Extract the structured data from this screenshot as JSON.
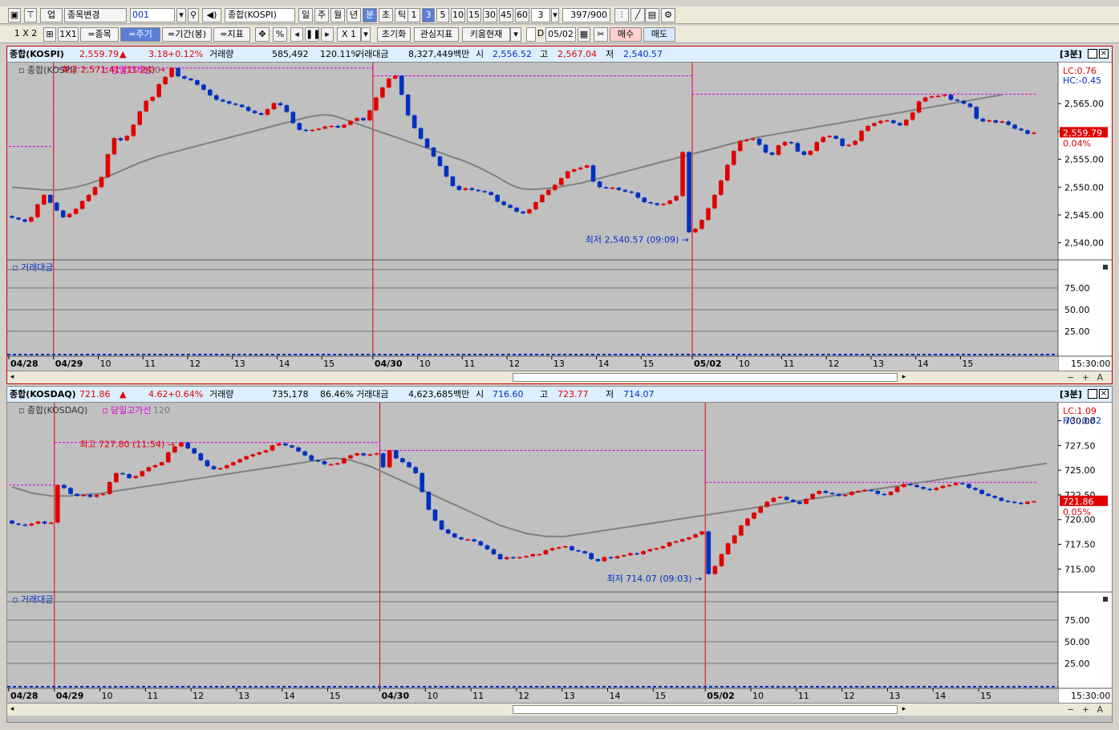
{
  "toolbar1": {
    "market": "업",
    "item_change": "종목변경",
    "code": "001",
    "index_name": "종합(KOSPI)",
    "periods": [
      "일",
      "주",
      "월",
      "년",
      "분",
      "초",
      "틱"
    ],
    "selected_period": "분",
    "intervals": [
      "1",
      "3",
      "5",
      "10",
      "15",
      "30",
      "45",
      "60"
    ],
    "selected_interval": "3",
    "interval_value": "3",
    "count": "397",
    "count_total": "/900"
  },
  "toolbar2": {
    "layout_label": "1 X 2",
    "onexone": "1X1",
    "item_btn": "=종목",
    "cycle_btn": "=주기",
    "term_btn": "=기간(봉)",
    "indicator_btn": "=지표",
    "percent": "%",
    "multiplier": "X 1",
    "reset_btn": "초기화",
    "interest_btn": "관심지표",
    "kiwoom_btn": "키움현재",
    "date_check": "D",
    "date": "05/02",
    "buy_btn": "매수",
    "sell_btn": "매도"
  },
  "panes": [
    {
      "header": {
        "name": "종합(KOSPI)",
        "price": "2,559.79",
        "arrow": "▲",
        "change": "3.18",
        "pct": "+0.12%",
        "vol_label": "거래량",
        "vol": "585,492",
        "vol_pct": "120.11%",
        "amt_label": "거래대금",
        "amt": "8,327,449백만",
        "open_label": "시",
        "open": "2,556.52",
        "high_label": "고",
        "high": "2,567.04",
        "low_label": "저",
        "low": "2,540.57",
        "period_label": "[3분]"
      },
      "chart_data": {
        "type": "candlestick",
        "legend": [
          "종합(KOSPI)",
          "당일고가선",
          "120"
        ],
        "lc": "LC:0.76",
        "hc": "HC:-0.45",
        "yticks": [
          "2,565.00",
          "2,560.00",
          "2,555.00",
          "2,550.00",
          "2,545.00",
          "2,540.00"
        ],
        "yvals": [
          2565,
          2560,
          2555,
          2550,
          2545,
          2540
        ],
        "ylim": [
          2537.5,
          2571.8
        ],
        "last_label": "2,559.79",
        "last_pct": "0.04%",
        "last": 2559.79,
        "high_annot": "최고 2,571.41 (11:24)",
        "high_value": 2571.41,
        "low_annot": "최저 2,540.57 (09:09)",
        "low_value": 2540.57,
        "close_series": [
          2544.5,
          2544.2,
          2543.8,
          2544.6,
          2546.9,
          2548.6,
          2547.2,
          2545.8,
          2544.6,
          2545.2,
          2546.1,
          2547.5,
          2548.6,
          2550.0,
          2551.8,
          2555.9,
          2558.8,
          2558.4,
          2559.2,
          2561.2,
          2563.6,
          2565.5,
          2566.2,
          2568.5,
          2569.8,
          2571.4,
          2569.9,
          2569.5,
          2569.2,
          2568.4,
          2567.5,
          2566.5,
          2565.7,
          2565.4,
          2565.0,
          2564.8,
          2564.4,
          2563.7,
          2563.3,
          2563.0,
          2564.0,
          2565.1,
          2564.7,
          2563.5,
          2561.5,
          2560.3,
          2560.1,
          2560.3,
          2560.5,
          2560.9,
          2561.0,
          2560.7,
          2561.2,
          2561.9,
          2562.4,
          2562.0,
          2563.8,
          2566.1,
          2567.9,
          2569.5,
          2570.0,
          2566.6,
          2562.9,
          2560.6,
          2558.7,
          2557.1,
          2555.5,
          2553.8,
          2551.9,
          2550.2,
          2549.5,
          2549.8,
          2549.5,
          2549.3,
          2549.1,
          2548.6,
          2547.4,
          2546.8,
          2546.3,
          2545.6,
          2545.3,
          2546.0,
          2547.3,
          2548.6,
          2549.5,
          2550.4,
          2551.6,
          2552.8,
          2553.2,
          2553.5,
          2553.9,
          2551.0,
          2550.0,
          2549.8,
          2549.9,
          2549.5,
          2549.2,
          2549.0,
          2548.1,
          2547.3,
          2547.1,
          2546.8,
          2547.0,
          2547.6,
          2548.4,
          2556.3,
          2541.9,
          2542.5,
          2544.1,
          2546.2,
          2548.6,
          2551.2,
          2554.0,
          2556.5,
          2558.3,
          2558.5,
          2558.7,
          2557.6,
          2556.2,
          2555.8,
          2557.5,
          2558.1,
          2557.9,
          2556.4,
          2555.8,
          2556.5,
          2558.1,
          2559.0,
          2559.2,
          2558.7,
          2557.4,
          2557.6,
          2558.3,
          2560.1,
          2561.0,
          2561.5,
          2561.9,
          2562.0,
          2561.5,
          2561.1,
          2562.1,
          2563.4,
          2565.4,
          2566.1,
          2566.3,
          2566.4,
          2566.6,
          2565.7,
          2565.5,
          2565.0,
          2564.4,
          2562.3,
          2561.8,
          2562.0,
          2561.6,
          2561.8,
          2561.2,
          2560.5,
          2560.2,
          2559.6,
          2559.8
        ],
        "ma120": [
          2550.0,
          2549.9,
          2549.8,
          2549.7,
          2549.6,
          2549.5,
          2549.5,
          2549.5,
          2549.6,
          2549.8,
          2550.0,
          2550.3,
          2550.6,
          2551.0,
          2551.4,
          2551.9,
          2552.4,
          2552.9,
          2553.4,
          2553.9,
          2554.4,
          2554.8,
          2555.2,
          2555.6,
          2555.9,
          2556.2,
          2556.5,
          2556.8,
          2557.1,
          2557.4,
          2557.7,
          2558.0,
          2558.3,
          2558.6,
          2558.9,
          2559.2,
          2559.5,
          2559.8,
          2560.1,
          2560.4,
          2560.7,
          2561.0,
          2561.3,
          2561.6,
          2561.9,
          2562.2,
          2562.5,
          2562.7,
          2562.9,
          2563.0,
          2562.9,
          2562.6,
          2562.2,
          2561.8,
          2561.4,
          2561.0,
          2560.6,
          2560.2,
          2559.8,
          2559.4,
          2559.0,
          2558.6,
          2558.2,
          2557.8,
          2557.4,
          2557.0,
          2556.6,
          2556.2,
          2555.8,
          2555.4,
          2555.0,
          2554.6,
          2554.1,
          2553.6,
          2553.0,
          2552.4,
          2551.8,
          2551.1,
          2550.5,
          2550.0,
          2549.7,
          2549.6,
          2549.6,
          2549.7,
          2549.8,
          2549.9,
          2550.1,
          2550.3,
          2550.5,
          2550.7,
          2551.0,
          2551.3,
          2551.6,
          2551.9,
          2552.2,
          2552.5,
          2552.8,
          2553.1,
          2553.4,
          2553.7,
          2554.0,
          2554.3,
          2554.6,
          2554.9,
          2555.2,
          2555.5,
          2555.8,
          2556.1,
          2556.4,
          2556.7,
          2557.0,
          2557.3,
          2557.6,
          2557.9,
          2558.2,
          2558.5,
          2558.8,
          2559.0,
          2559.2,
          2559.4,
          2559.6,
          2559.8,
          2560.0,
          2560.2,
          2560.4,
          2560.6,
          2560.8,
          2561.0,
          2561.2,
          2561.4,
          2561.6,
          2561.8,
          2562.0,
          2562.2,
          2562.4,
          2562.6,
          2562.8,
          2563.0,
          2563.2,
          2563.4,
          2563.6,
          2563.8,
          2564.0,
          2564.2,
          2564.4,
          2564.6,
          2564.8,
          2565.0,
          2565.2,
          2565.4,
          2565.6,
          2565.8,
          2566.0,
          2566.2,
          2566.4,
          2566.6
        ],
        "day_starts": [
          7,
          57,
          107
        ],
        "day_high": [
          2557.3,
          2571.4,
          2570.0,
          2566.7
        ],
        "sub_title": "거래대금",
        "sub_yticks": [
          "75.00",
          "50.00",
          "25.00"
        ],
        "sub_yvals": [
          75,
          50,
          25
        ],
        "time_right": "15:30:00",
        "x_labels": [
          {
            "i": 0,
            "t": "04/28"
          },
          {
            "i": 7,
            "t": "04/29"
          },
          {
            "i": 14,
            "t": "10"
          },
          {
            "i": 21,
            "t": "11"
          },
          {
            "i": 28,
            "t": "12"
          },
          {
            "i": 35,
            "t": "13"
          },
          {
            "i": 42,
            "t": "14"
          },
          {
            "i": 49,
            "t": "15"
          },
          {
            "i": 57,
            "t": "04/30"
          },
          {
            "i": 64,
            "t": "10"
          },
          {
            "i": 71,
            "t": "11"
          },
          {
            "i": 78,
            "t": "12"
          },
          {
            "i": 85,
            "t": "13"
          },
          {
            "i": 92,
            "t": "14"
          },
          {
            "i": 99,
            "t": "15"
          },
          {
            "i": 107,
            "t": "05/02"
          },
          {
            "i": 114,
            "t": "10"
          },
          {
            "i": 121,
            "t": "11"
          },
          {
            "i": 128,
            "t": "12"
          },
          {
            "i": 135,
            "t": "13"
          },
          {
            "i": 142,
            "t": "14"
          },
          {
            "i": 149,
            "t": "15"
          }
        ]
      }
    },
    {
      "header": {
        "name": "종합(KOSDAQ)",
        "price": "721.86",
        "arrow": "▲",
        "change": "4.62",
        "pct": "+0.64%",
        "vol_label": "거래량",
        "vol": "735,178",
        "vol_pct": "86.46%",
        "amt_label": "거래대금",
        "amt": "4,623,685백만",
        "open_label": "시",
        "open": "716.60",
        "high_label": "고",
        "high": "723.77",
        "low_label": "저",
        "low": "714.07",
        "period_label": "[3분]"
      },
      "chart_data": {
        "type": "candlestick",
        "legend": [
          "종합(KOSDAQ)",
          "당일고가선",
          "120"
        ],
        "lc": "LC:1.09",
        "hc": "HC:-0.82",
        "yticks": [
          "730.00",
          "727.50",
          "725.00",
          "722.50",
          "720.00",
          "717.50",
          "715.00"
        ],
        "yvals": [
          730,
          727.5,
          725,
          722.5,
          720,
          717.5,
          715
        ],
        "ylim": [
          713.0,
          731.5
        ],
        "last_label": "721.86",
        "last_pct": "0.05%",
        "last": 721.86,
        "high_annot": "최고 727.80 (11:54)",
        "high_value": 727.8,
        "low_annot": "최저 714.07 (09:03)",
        "low_value": 714.07,
        "close_series": [
          719.6,
          719.5,
          719.4,
          719.6,
          719.8,
          719.6,
          719.7,
          723.5,
          723.2,
          722.6,
          722.4,
          722.5,
          722.3,
          722.5,
          722.6,
          723.8,
          724.7,
          724.6,
          724.2,
          724.4,
          724.9,
          725.3,
          725.5,
          725.8,
          726.8,
          727.4,
          727.8,
          727.2,
          726.7,
          726.0,
          725.4,
          725.1,
          725.2,
          725.5,
          725.8,
          726.1,
          726.4,
          726.6,
          726.8,
          727.0,
          727.5,
          727.7,
          727.5,
          727.3,
          726.9,
          726.5,
          726.0,
          725.9,
          725.6,
          725.6,
          725.7,
          726.2,
          726.5,
          726.7,
          726.5,
          726.6,
          726.7,
          725.3,
          727.0,
          726.2,
          725.8,
          725.3,
          724.7,
          722.8,
          721.0,
          719.9,
          719.0,
          718.6,
          718.2,
          718.0,
          718.0,
          717.8,
          717.4,
          717.0,
          716.5,
          716.0,
          716.2,
          716.1,
          716.2,
          716.3,
          716.5,
          716.5,
          716.9,
          717.1,
          717.2,
          717.3,
          716.9,
          716.8,
          716.6,
          716.0,
          715.8,
          716.2,
          716.1,
          716.3,
          716.4,
          716.6,
          716.5,
          716.8,
          717.0,
          717.1,
          717.3,
          717.7,
          717.8,
          718.0,
          718.2,
          718.5,
          718.8,
          714.5,
          715.3,
          716.5,
          717.6,
          718.4,
          719.4,
          720.1,
          720.7,
          721.3,
          721.8,
          722.2,
          722.3,
          722.0,
          721.8,
          721.6,
          722.1,
          722.6,
          722.9,
          722.7,
          722.6,
          722.4,
          722.5,
          722.8,
          722.9,
          723.0,
          722.9,
          722.6,
          722.5,
          722.8,
          723.3,
          723.6,
          723.5,
          723.3,
          723.1,
          723.0,
          723.2,
          723.4,
          723.5,
          723.7,
          723.6,
          723.2,
          723.0,
          722.6,
          722.4,
          722.2,
          721.9,
          721.8,
          721.7,
          721.6,
          721.8,
          721.86
        ],
        "ma120": [
          723.3,
          723.1,
          722.9,
          722.7,
          722.6,
          722.5,
          722.4,
          722.4,
          722.4,
          722.4,
          722.5,
          722.5,
          722.6,
          722.6,
          722.7,
          722.8,
          722.9,
          723.0,
          723.1,
          723.2,
          723.3,
          723.4,
          723.5,
          723.6,
          723.7,
          723.8,
          723.9,
          724.0,
          724.1,
          724.2,
          724.3,
          724.4,
          724.5,
          724.6,
          724.7,
          724.8,
          724.9,
          725.0,
          725.1,
          725.2,
          725.3,
          725.4,
          725.5,
          725.6,
          725.7,
          725.8,
          725.9,
          726.0,
          726.1,
          726.2,
          726.2,
          726.1,
          726.0,
          725.8,
          725.6,
          725.4,
          725.1,
          724.8,
          724.5,
          724.2,
          723.9,
          723.6,
          723.3,
          723.0,
          722.7,
          722.4,
          722.1,
          721.8,
          721.5,
          721.2,
          720.9,
          720.6,
          720.3,
          720.0,
          719.7,
          719.4,
          719.2,
          719.0,
          718.8,
          718.6,
          718.5,
          718.4,
          718.3,
          718.3,
          718.3,
          718.3,
          718.4,
          718.5,
          718.6,
          718.7,
          718.8,
          718.9,
          719.0,
          719.1,
          719.2,
          719.3,
          719.4,
          719.5,
          719.6,
          719.7,
          719.8,
          719.9,
          720.0,
          720.1,
          720.2,
          720.3,
          720.4,
          720.5,
          720.6,
          720.7,
          720.8,
          720.9,
          721.0,
          721.1,
          721.2,
          721.3,
          721.4,
          721.5,
          721.6,
          721.7,
          721.8,
          721.9,
          722.0,
          722.1,
          722.2,
          722.3,
          722.4,
          722.5,
          722.6,
          722.7,
          722.8,
          722.9,
          723.0,
          723.1,
          723.2,
          723.3,
          723.4,
          723.5,
          723.6,
          723.7,
          723.8,
          723.9,
          724.0,
          724.1,
          724.2,
          724.3,
          724.4,
          724.5,
          724.6,
          724.7,
          724.8,
          724.9,
          725.0,
          725.1,
          725.2,
          725.3,
          725.4,
          725.5,
          725.6,
          725.7
        ],
        "day_starts": [
          7,
          57,
          107
        ],
        "day_high": [
          723.5,
          727.8,
          727.0,
          723.77
        ],
        "sub_title": "거래대금",
        "sub_yticks": [
          "75.00",
          "50.00",
          "25.00"
        ],
        "sub_yvals": [
          75,
          50,
          25
        ],
        "time_right": "15:30:00",
        "x_labels": [
          {
            "i": 0,
            "t": "04/28"
          },
          {
            "i": 7,
            "t": "04/29"
          },
          {
            "i": 14,
            "t": "10"
          },
          {
            "i": 21,
            "t": "11"
          },
          {
            "i": 28,
            "t": "12"
          },
          {
            "i": 35,
            "t": "13"
          },
          {
            "i": 42,
            "t": "14"
          },
          {
            "i": 49,
            "t": "15"
          },
          {
            "i": 57,
            "t": "04/30"
          },
          {
            "i": 64,
            "t": "10"
          },
          {
            "i": 71,
            "t": "11"
          },
          {
            "i": 78,
            "t": "12"
          },
          {
            "i": 85,
            "t": "13"
          },
          {
            "i": 92,
            "t": "14"
          },
          {
            "i": 99,
            "t": "15"
          },
          {
            "i": 107,
            "t": "05/02"
          },
          {
            "i": 114,
            "t": "10"
          },
          {
            "i": 121,
            "t": "11"
          },
          {
            "i": 128,
            "t": "12"
          },
          {
            "i": 135,
            "t": "13"
          },
          {
            "i": 142,
            "t": "14"
          },
          {
            "i": 149,
            "t": "15"
          }
        ]
      }
    }
  ],
  "colors": {
    "up": "#e00000",
    "down": "#0030c0",
    "ma": "#808080",
    "dayhigh": "#e000e0",
    "grid": "#808080",
    "bg": "#c0c0c0",
    "last_bg": "#e00000"
  },
  "bottom_tools_icons": [
    "zoom-in-icon",
    "zoom-out-icon",
    "text-icon"
  ],
  "bottom_tools_text": "− + A"
}
